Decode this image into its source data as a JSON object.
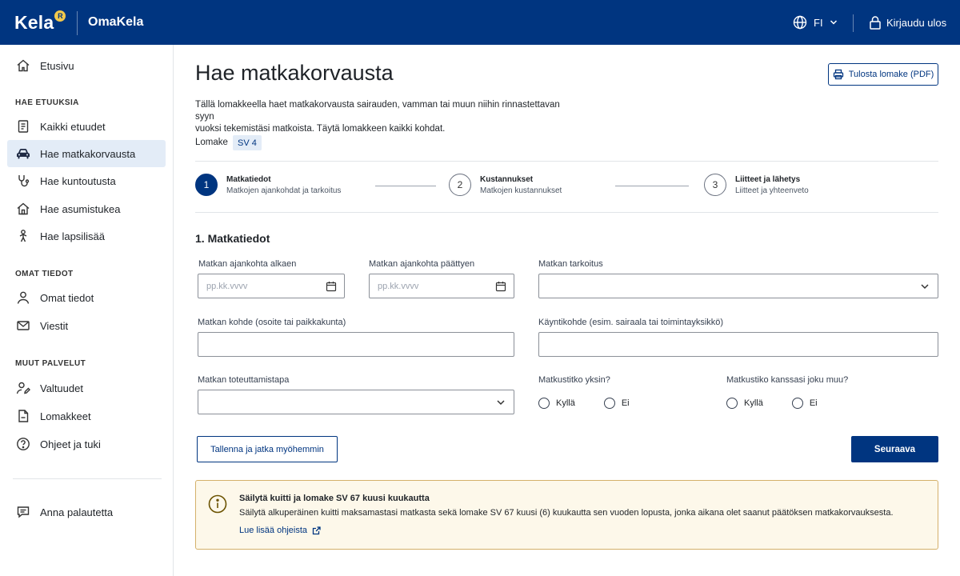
{
  "header": {
    "logo_text": "Kela",
    "logo_badge": "R",
    "app_name": "OmaKela",
    "language": "FI",
    "logout_label": "Kirjaudu ulos"
  },
  "sidebar": {
    "home": "Etusivu",
    "sections": [
      {
        "title": "HAE ETUUKSIA",
        "items": [
          "Kaikki etuudet",
          "Hae matkakorvausta",
          "Hae kuntoutusta",
          "Hae asumistukea",
          "Hae lapsilisää"
        ]
      },
      {
        "title": "OMAT TIEDOT",
        "items": [
          "Omat tiedot",
          "Viestit"
        ]
      },
      {
        "title": "MUUT PALVELUT",
        "items": [
          "Valtuudet",
          "Lomakkeet",
          "Ohjeet ja tuki"
        ]
      }
    ],
    "feedback": "Anna palautetta",
    "active_item": "Hae matkakorvausta"
  },
  "page": {
    "title": "Hae matkakorvausta",
    "print_button": "Tulosta lomake (PDF)",
    "intro_line1": "Tällä lomakkeella haet matkakorvausta sairauden, vamman tai muun niihin rinnastettavan syyn",
    "intro_line2": "vuoksi tekemistäsi matkoista. Täytä lomakkeen kaikki kohdat.",
    "form_label": "Lomake",
    "form_code": "SV 4"
  },
  "stepper": [
    {
      "number": "1",
      "title": "Matkatiedot",
      "subtitle": "Matkojen ajankohdat ja tarkoitus",
      "active": true
    },
    {
      "number": "2",
      "title": "Kustannukset",
      "subtitle": "Matkojen kustannukset",
      "active": false
    },
    {
      "number": "3",
      "title": "Liitteet ja lähetys",
      "subtitle": "Liitteet ja yhteenveto",
      "active": false
    }
  ],
  "form": {
    "section_title": "1. Matkatiedot",
    "start_date_label": "Matkan ajankohta alkaen",
    "start_date_placeholder": "pp.kk.vvvv",
    "end_date_label": "Matkan ajankohta päättyen",
    "end_date_placeholder": "pp.kk.vvvv",
    "purpose_label": "Matkan tarkoitus",
    "destination_label": "Matkan kohde (osoite tai paikkakunta)",
    "visit_label": "Käyntikohde (esim. sairaala tai toimintayksikkö)",
    "mode_label": "Matkan toteuttamistapa",
    "alone_label": "Matkustitko yksin?",
    "companion_label": "Matkustiko kanssasi joku muu?",
    "yes": "Kyllä",
    "no": "Ei",
    "save_button": "Tallenna ja jatka myöhemmin",
    "next_button": "Seuraava"
  },
  "notice": {
    "title": "Säilytä kuitti ja lomake SV 67 kuusi kuukautta",
    "body": "Säilytä alkuperäinen kuitti maksamastasi matkasta sekä lomake SV 67 kuusi (6) kuukautta sen vuoden lopusta, jonka aikana olet saanut päätöksen matkakorvauksesta.",
    "link": "Lue lisää ohjeista"
  },
  "colors": {
    "brand": "#003580",
    "active_bg": "#e3ecf7",
    "notice_bg": "#fdf8ea",
    "notice_border": "#d4b06a"
  }
}
